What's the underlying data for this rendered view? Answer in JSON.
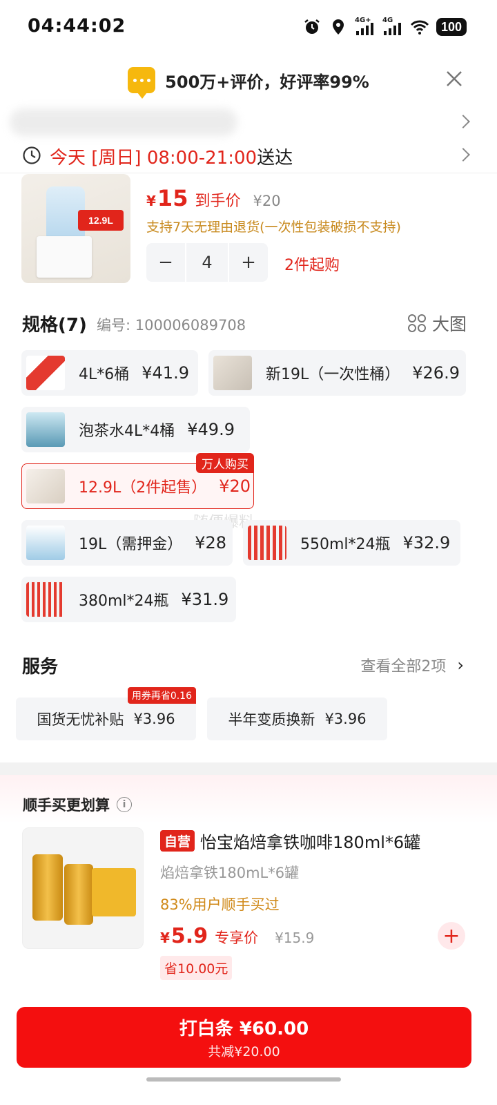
{
  "status_bar": {
    "time": "04:44:02",
    "network_1": "4G+",
    "network_2": "4G",
    "battery": "100",
    "icons": [
      "alarm-icon",
      "location-icon",
      "signal-icon",
      "signal-icon",
      "wifi-icon",
      "battery-icon"
    ]
  },
  "banner": {
    "text": "500万+评价，好评率99%",
    "icon": "chat-bubble-icon"
  },
  "delivery": {
    "time_text": "今天 [周日] 08:00-21:00",
    "suffix": "送达"
  },
  "product": {
    "image_tag": "12.9L",
    "currency": "¥",
    "price": "15",
    "price_label": "到手价",
    "original_price": "¥20",
    "return_policy": "支持7天无理由退货(一次性包装破损不支持)",
    "quantity": "4",
    "min_purchase": "2件起购"
  },
  "spec": {
    "title": "规格(7)",
    "code": "编号: 100006089708",
    "big_image_label": "大图",
    "options": [
      {
        "label": "4L*6桶",
        "price": "¥41.9"
      },
      {
        "label": "新19L（一次性桶）",
        "price": "¥26.9"
      },
      {
        "label": "泡茶水4L*4桶",
        "price": "¥49.9"
      },
      {
        "label": "12.9L（2件起售）",
        "price": "¥20",
        "badge": "万人购买",
        "selected": true
      },
      {
        "label": "19L（需押金）",
        "price": "¥28"
      },
      {
        "label": "550ml*24瓶",
        "price": "¥32.9"
      },
      {
        "label": "380ml*24瓶",
        "price": "¥31.9"
      }
    ],
    "watermark": "随便爆料"
  },
  "service": {
    "title": "服务",
    "view_all": "查看全部2项",
    "items": [
      {
        "label": "国货无忧补贴",
        "price": "¥3.96",
        "badge": "用券再省0.16"
      },
      {
        "label": "半年变质换新",
        "price": "¥3.96"
      }
    ]
  },
  "recommend": {
    "title": "顺手买更划算",
    "self_tag": "自营",
    "name": "怡宝焰焙拿铁咖啡180ml*6罐",
    "sub": "焰焙拿铁180mL*6罐",
    "bought": "83%用户顺手买过",
    "currency": "¥",
    "price": "5.9",
    "price_label": "专享价",
    "original_price": "¥15.9",
    "save": "省10.00元"
  },
  "pay": {
    "main": "打白条 ¥60.00",
    "sub": "共减¥20.00"
  },
  "colors": {
    "accent": "#e1251b",
    "button": "#f40f0f",
    "orange_text": "#c88a1e"
  }
}
